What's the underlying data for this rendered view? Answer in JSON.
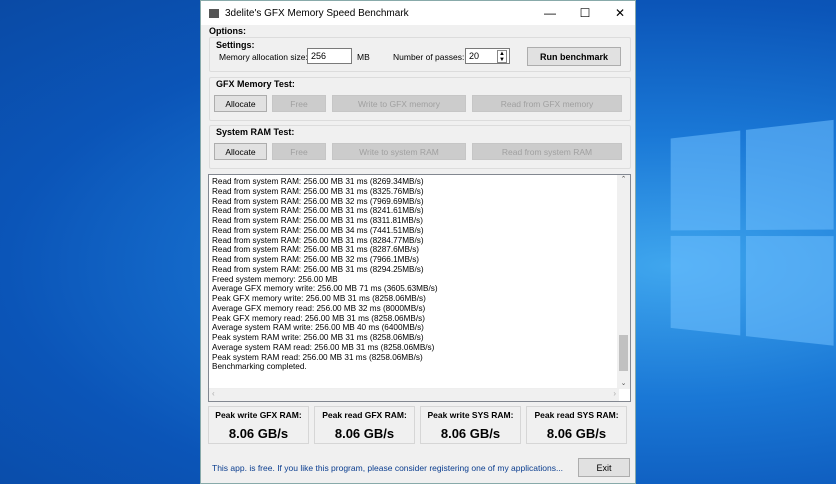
{
  "window": {
    "title": "3delite's GFX Memory Speed Benchmark",
    "minimize": "—",
    "maximize": "☐",
    "close": "✕"
  },
  "options_label": "Options:",
  "settings": {
    "label": "Settings:",
    "mem_size_label": "Memory allocation size:",
    "mem_size_value": "256",
    "mem_unit": "MB",
    "passes_label": "Number of passes:",
    "passes_value": "20",
    "run_button": "Run benchmark"
  },
  "gfx_test": {
    "label": "GFX Memory Test:",
    "allocate": "Allocate",
    "free": "Free",
    "write": "Write to GFX memory",
    "read": "Read from GFX memory"
  },
  "sys_test": {
    "label": "System RAM Test:",
    "allocate": "Allocate",
    "free": "Free",
    "write": "Write to system RAM",
    "read": "Read from system RAM"
  },
  "log": [
    "Read from system RAM: 256.00 MB 31 ms (8269.34MB/s)",
    "Read from system RAM: 256.00 MB 31 ms (8325.76MB/s)",
    "Read from system RAM: 256.00 MB 32 ms (7969.69MB/s)",
    "Read from system RAM: 256.00 MB 31 ms (8241.61MB/s)",
    "Read from system RAM: 256.00 MB 31 ms (8311.81MB/s)",
    "Read from system RAM: 256.00 MB 34 ms (7441.51MB/s)",
    "Read from system RAM: 256.00 MB 31 ms (8284.77MB/s)",
    "Read from system RAM: 256.00 MB 31 ms (8287.6MB/s)",
    "Read from system RAM: 256.00 MB 32 ms (7966.1MB/s)",
    "Read from system RAM: 256.00 MB 31 ms (8294.25MB/s)",
    "Freed system memory: 256.00 MB",
    "Average GFX memory write: 256.00 MB 71 ms (3605.63MB/s)",
    "Peak GFX memory write: 256.00 MB 31 ms (8258.06MB/s)",
    "Average GFX memory read: 256.00 MB 32 ms (8000MB/s)",
    "Peak GFX memory read: 256.00 MB 31 ms (8258.06MB/s)",
    "Average system RAM write: 256.00 MB 40 ms (6400MB/s)",
    "Peak system RAM write: 256.00 MB 31 ms (8258.06MB/s)",
    "Average system RAM read: 256.00 MB 31 ms (8258.06MB/s)",
    "Peak system RAM read: 256.00 MB 31 ms (8258.06MB/s)",
    "Benchmarking completed."
  ],
  "results": [
    {
      "label": "Peak write GFX RAM:",
      "value": "8.06 GB/s"
    },
    {
      "label": "Peak read GFX RAM:",
      "value": "8.06 GB/s"
    },
    {
      "label": "Peak write SYS RAM:",
      "value": "8.06 GB/s"
    },
    {
      "label": "Peak read SYS RAM:",
      "value": "8.06 GB/s"
    }
  ],
  "footer": {
    "text": "This app. is free. If you like this program, please consider registering one of my applications...",
    "exit": "Exit",
    "link_color": "#0a3d8f"
  }
}
